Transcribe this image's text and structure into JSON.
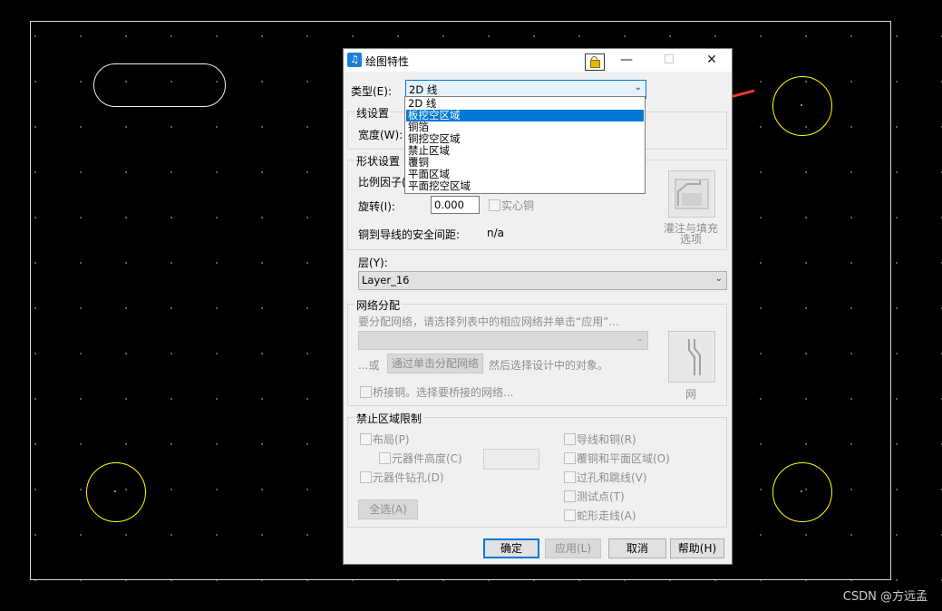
{
  "dialog": {
    "title": "绘图特性",
    "type_label": "类型(E):",
    "type_value": "2D 线",
    "type_options": [
      "2D 线",
      "板挖空区域",
      "铜箔",
      "铜挖空区域",
      "禁止区域",
      "覆铜",
      "平面区域",
      "平面挖空区域"
    ],
    "type_selected_index": 1,
    "line_group": "线设置",
    "width_label": "宽度(W):",
    "shape_group": "形状设置",
    "scale_label": "比例因子(",
    "rotate_label": "旋转(I):",
    "rotate_value": "0.000",
    "solid_copper_label": "实心铜",
    "clearance_label": "铜到导线的安全间距:",
    "clearance_value": "n/a",
    "pour_fill_label": "灌注与填充\n选项",
    "layer_label": "层(Y):",
    "layer_value": "Layer_16",
    "net_group": "网络分配",
    "net_hint": "要分配网络，请选择列表中的相应网络并单击“应用”...",
    "or_label": "...或",
    "assign_net_button": "通过单击分配网络",
    "assign_net_after": "然后选择设计中的对象。",
    "bridge_copper_label": "桥接铜。选择要桥接的网络...",
    "net_button_label": "网",
    "keepout_group": "禁止区域限制",
    "restrictions_left": [
      "布局(P)",
      "元器件高度(C)",
      "元器件钻孔(D)"
    ],
    "restrictions_right": [
      "导线和铜(R)",
      "覆铜和平面区域(O)",
      "过孔和跳线(V)",
      "测试点(T)",
      "蛇形走线(A)"
    ],
    "select_all_button": "全选(A)",
    "ok_button": "确定",
    "apply_button": "应用(L)",
    "cancel_button": "取消",
    "help_button": "帮助(H)"
  },
  "window_controls": {
    "minimize": "—",
    "maximize": "☐",
    "close": "✕"
  },
  "watermark": "CSDN @方远孟",
  "colors": {
    "canvas": "#000000",
    "board_outline": "#d8d8d8",
    "hole": "#ffff00",
    "arrow": "#e8382f",
    "selection": "#0078d7"
  }
}
